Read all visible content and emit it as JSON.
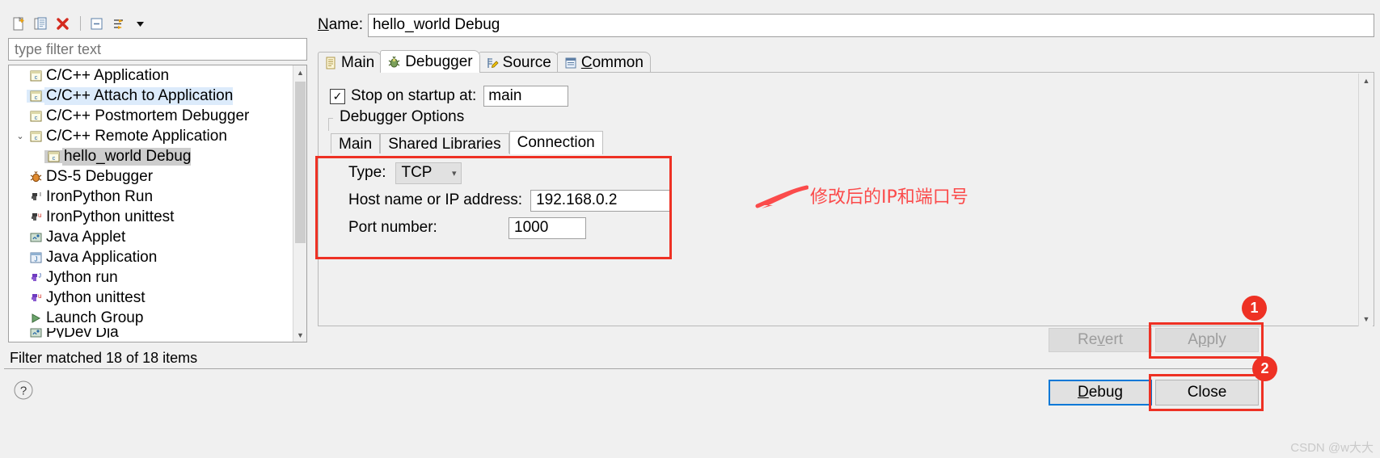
{
  "toolbar": {
    "icons": [
      {
        "name": "new-launch-configuration-icon",
        "glyph": "new-file"
      },
      {
        "name": "duplicate-launch-configuration-icon",
        "glyph": "copy"
      },
      {
        "name": "delete-launch-configuration-icon",
        "glyph": "delete"
      },
      {
        "name": "collapse-all-icon",
        "glyph": "collapse"
      },
      {
        "name": "filter-launch-configurations-icon",
        "glyph": "filter"
      },
      {
        "name": "view-menu-icon",
        "glyph": "chevron-down"
      }
    ]
  },
  "filter": {
    "placeholder": "type filter text",
    "value": "",
    "status": "Filter matched 18 of 18 items"
  },
  "tree": {
    "items": [
      {
        "label": "C/C++ Application",
        "icon": "c-launch-icon",
        "indent": 0,
        "twisty": "",
        "state": "normal"
      },
      {
        "label": "C/C++ Attach to Application",
        "icon": "c-launch-icon",
        "indent": 0,
        "twisty": "",
        "state": "hover"
      },
      {
        "label": "C/C++ Postmortem Debugger",
        "icon": "c-launch-icon",
        "indent": 0,
        "twisty": "",
        "state": "normal"
      },
      {
        "label": "C/C++ Remote Application",
        "icon": "c-launch-icon",
        "indent": 0,
        "twisty": "⌄",
        "state": "normal"
      },
      {
        "label": "hello_world Debug",
        "icon": "c-launch-icon",
        "indent": 1,
        "twisty": "",
        "state": "selected"
      },
      {
        "label": "DS-5 Debugger",
        "icon": "ds5-icon",
        "indent": 0,
        "twisty": "",
        "state": "normal"
      },
      {
        "label": "IronPython Run",
        "icon": "python-run-icon",
        "indent": 0,
        "twisty": "",
        "state": "normal"
      },
      {
        "label": "IronPython unittest",
        "icon": "python-unittest-icon",
        "indent": 0,
        "twisty": "",
        "state": "normal"
      },
      {
        "label": "Java Applet",
        "icon": "java-applet-icon",
        "indent": 0,
        "twisty": "",
        "state": "normal"
      },
      {
        "label": "Java Application",
        "icon": "java-application-icon",
        "indent": 0,
        "twisty": "",
        "state": "normal"
      },
      {
        "label": "Jython run",
        "icon": "jython-run-icon",
        "indent": 0,
        "twisty": "",
        "state": "normal"
      },
      {
        "label": "Jython unittest",
        "icon": "jython-unittest-icon",
        "indent": 0,
        "twisty": "",
        "state": "normal"
      },
      {
        "label": "Launch Group",
        "icon": "launch-group-icon",
        "indent": 0,
        "twisty": "",
        "state": "normal"
      }
    ]
  },
  "config": {
    "name_label": "Name:",
    "name_value": "hello_world Debug"
  },
  "tabs": [
    {
      "label": "Main",
      "icon": "document-icon",
      "active": false
    },
    {
      "label": "Debugger",
      "icon": "bug-icon",
      "active": true
    },
    {
      "label": "Source",
      "icon": "source-icon",
      "active": false
    },
    {
      "label": "Common",
      "icon": "common-icon",
      "active": false
    }
  ],
  "debugger": {
    "stop_on_startup_label": "Stop on startup at:",
    "stop_on_startup_checked": true,
    "stop_on_startup_value": "main",
    "options_group_title": "Debugger Options",
    "inner_tabs": [
      {
        "label": "Main",
        "active": false
      },
      {
        "label": "Shared Libraries",
        "active": false
      },
      {
        "label": "Connection",
        "active": true
      }
    ],
    "connection": {
      "type_label": "Type:",
      "type_value": "TCP",
      "host_label": "Host name or IP address:",
      "host_value": "192.168.0.2",
      "port_label": "Port number:",
      "port_value": "1000"
    }
  },
  "annotation": {
    "text": "修改后的IP和端口号",
    "color": "#fb4b4b",
    "badge_1": "1",
    "badge_2": "2"
  },
  "buttons": {
    "revert": "Revert",
    "apply": "Apply",
    "debug": "Debug",
    "close": "Close"
  },
  "help": {
    "icon": "help-icon",
    "label": "?"
  },
  "watermark": "CSDN @w大大"
}
